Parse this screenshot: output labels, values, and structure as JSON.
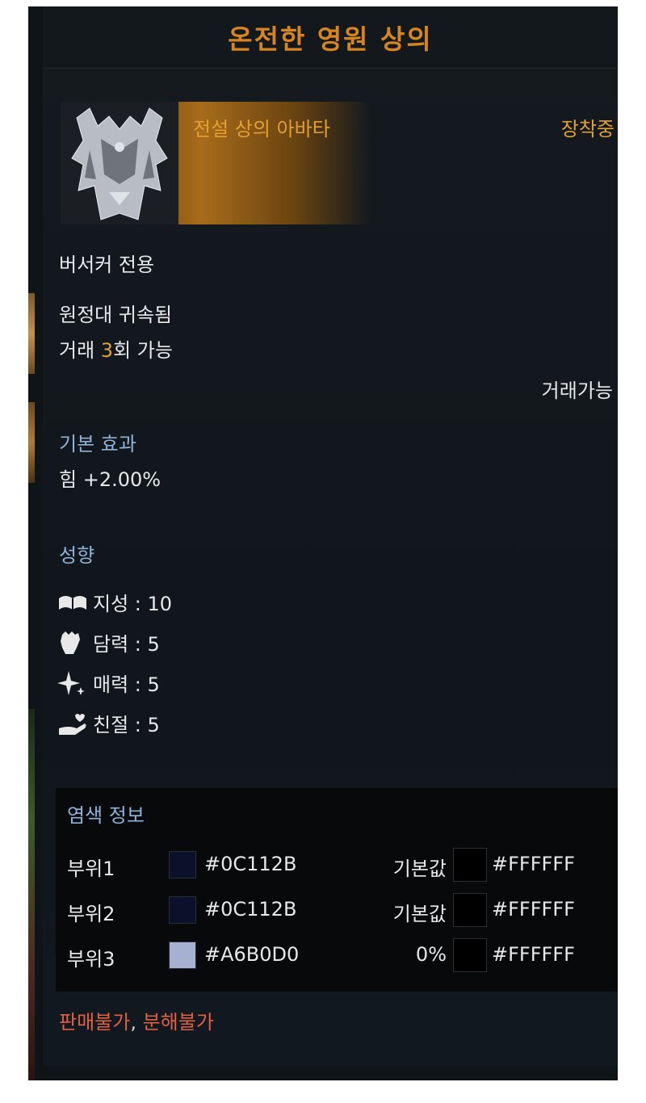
{
  "tooltip": {
    "title": "온전한 영원 상의",
    "grade": "전설 상의 아바타",
    "equipped": "장착중",
    "class_restriction": "버서커 전용",
    "bound": "원정대 귀속됨",
    "trade_prefix": "거래 ",
    "trade_count": "3",
    "trade_suffix": "회 가능",
    "tradable": "거래가능",
    "basic_effect": {
      "title": "기본 효과",
      "value": "힘 +2.00%"
    },
    "traits": {
      "title": "성향",
      "items": [
        {
          "icon": "book-icon",
          "label": "지성 : 10"
        },
        {
          "icon": "fist-icon",
          "label": "담력 : 5"
        },
        {
          "icon": "sparkle-icon",
          "label": "매력 : 5"
        },
        {
          "icon": "heart-hand-icon",
          "label": "친절 : 5"
        }
      ]
    },
    "dye": {
      "title": "염색 정보",
      "rows": [
        {
          "part": "부위1",
          "color": "#0C112B",
          "hex": "#0C112B",
          "default": "기본값",
          "hex2": "#FFFFFF"
        },
        {
          "part": "부위2",
          "color": "#0C112B",
          "hex": "#0C112B",
          "default": "기본값",
          "hex2": "#FFFFFF"
        },
        {
          "part": "부위3",
          "color": "#A6B0D0",
          "hex": "#A6B0D0",
          "default": "0%",
          "hex2": "#FFFFFF"
        }
      ]
    },
    "footer": {
      "no_sell": "판매불가",
      "separator": ", ",
      "no_dismantle": "분해불가"
    }
  },
  "colors": {
    "title": "#d8841f",
    "accent": "#e2a030",
    "section": "#8fb2d8",
    "warning": "#e06040"
  }
}
